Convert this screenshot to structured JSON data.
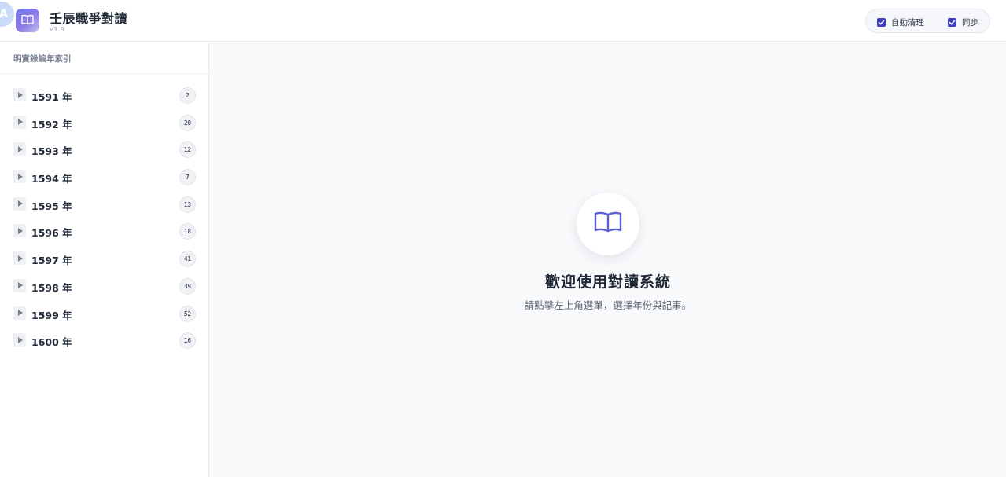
{
  "header": {
    "avatar_text": "A",
    "title": "壬辰戰爭對讀",
    "version": "v3.9",
    "toggles": [
      {
        "label": "自動清理",
        "checked": true
      },
      {
        "label": "同步",
        "checked": true
      }
    ]
  },
  "sidebar": {
    "heading": "明實錄編年索引",
    "years": [
      {
        "label": "1591 年",
        "count": "2"
      },
      {
        "label": "1592 年",
        "count": "20"
      },
      {
        "label": "1593 年",
        "count": "12"
      },
      {
        "label": "1594 年",
        "count": "7"
      },
      {
        "label": "1595 年",
        "count": "13"
      },
      {
        "label": "1596 年",
        "count": "18"
      },
      {
        "label": "1597 年",
        "count": "41"
      },
      {
        "label": "1598 年",
        "count": "39"
      },
      {
        "label": "1599 年",
        "count": "52"
      },
      {
        "label": "1600 年",
        "count": "16"
      }
    ]
  },
  "main": {
    "welcome_title": "歡迎使用對讀系統",
    "welcome_subtitle": "請點擊左上角選單，選擇年份與記事。"
  },
  "colors": {
    "accent": "#3c3fc1",
    "book_icon": "#5a5fd6",
    "logo_gradient_start": "#6f78ee",
    "logo_gradient_end": "#c4c8f2"
  },
  "icons": {
    "logo": "open-book-icon",
    "expander": "triangle-right-icon",
    "checkbox": "checkmark-icon",
    "welcome": "open-book-icon"
  }
}
